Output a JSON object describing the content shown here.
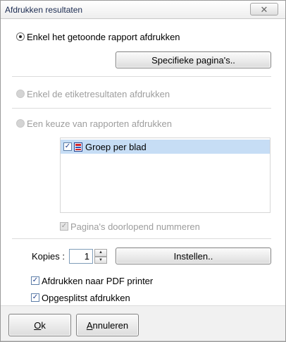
{
  "window": {
    "title": "Afdrukken resultaten",
    "close_glyph": "✕"
  },
  "options": {
    "print_shown_report": "Enkel het getoonde rapport afdrukken",
    "specific_pages_button": "Specifieke pagina's..",
    "print_label_results": "Enkel de etiketresultaten afdrukken",
    "choose_reports": "Een keuze van rapporten afdrukken"
  },
  "report_list": {
    "items": [
      {
        "label": "Groep per blad",
        "checked": true,
        "icon": "report-icon"
      }
    ]
  },
  "continuous_numbering": "Pagina's doorlopend nummeren",
  "copies": {
    "label": "Kopies :",
    "value": "1",
    "settings_button": "Instellen.."
  },
  "checkboxes": {
    "pdf_printer": "Afdrukken naar PDF printer",
    "split_print": "Opgesplitst afdrukken"
  },
  "buttons": {
    "ok_mnemonic": "O",
    "ok_rest": "k",
    "cancel_mnemonic": "A",
    "cancel_rest": "nnuleren"
  },
  "colors": {
    "selection": "#c6ddf5",
    "disabled_text": "#9d9d9d",
    "footer_bg": "#f1f1f1"
  }
}
